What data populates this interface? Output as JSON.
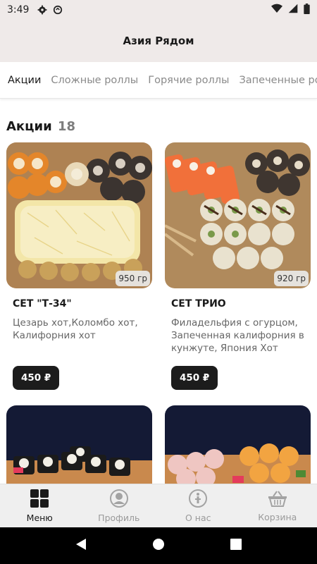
{
  "status": {
    "time": "3:49"
  },
  "header": {
    "title": "Азия Рядом"
  },
  "tabs": [
    {
      "label": "Акции"
    },
    {
      "label": "Сложные роллы"
    },
    {
      "label": "Горячие роллы"
    },
    {
      "label": "Запеченные роллы"
    }
  ],
  "section": {
    "title": "Акции",
    "count": "18"
  },
  "products": [
    {
      "name": "СЕТ \"Т-34\"",
      "description": "Цезарь хот,Коломбо хот, Калифорния хот",
      "weight": "950 гр",
      "price": "450 ₽"
    },
    {
      "name": "СЕТ ТРИО",
      "description": "Филадельфия с огурцом, Запеченная калифорния в кунжуте, Япония Хот",
      "weight": "920 гр",
      "price": "450 ₽"
    }
  ],
  "bottom_nav": [
    {
      "label": "Меню",
      "icon": "grid-icon"
    },
    {
      "label": "Профиль",
      "icon": "profile-icon"
    },
    {
      "label": "О нас",
      "icon": "info-icon"
    },
    {
      "label": "Корзина",
      "icon": "basket-icon"
    }
  ],
  "colors": {
    "accent": "#1c1c1c",
    "header_bg": "#efeae9",
    "nav_bg": "#efefef"
  }
}
